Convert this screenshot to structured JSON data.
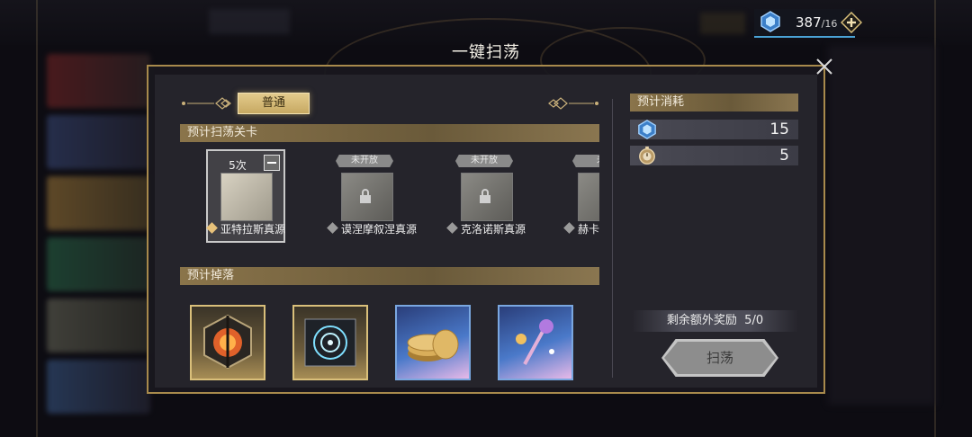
{
  "currency": {
    "amount": "387",
    "max": "/16",
    "icon": "stamina-crystal-icon",
    "add_icon": "plus-icon"
  },
  "dialog": {
    "title": "一键扫荡",
    "close_icon": "close-icon"
  },
  "tabs": [
    {
      "label": "普通",
      "selected": true
    }
  ],
  "stages_section": {
    "label": "预计扫荡关卡",
    "stages": [
      {
        "name": "亚特拉斯真源",
        "count": "5次",
        "selected": true,
        "locked": false
      },
      {
        "name": "谟涅摩叙涅真源",
        "locked_label": "未开放",
        "locked": true
      },
      {
        "name": "克洛诺斯真源",
        "locked_label": "未开放",
        "locked": true
      },
      {
        "name": "赫卡",
        "locked_label": "未",
        "locked": true
      }
    ]
  },
  "drops_section": {
    "label": "预计掉落",
    "items": [
      {
        "icon": "mystery-cube-icon",
        "rarity": "gold"
      },
      {
        "icon": "astrolabe-record-icon",
        "rarity": "gold"
      },
      {
        "icon": "gold-coins-icon",
        "rarity": "blue"
      },
      {
        "icon": "crystal-wand-icon",
        "rarity": "blue"
      }
    ]
  },
  "cost_section": {
    "label": "预计消耗",
    "rows": [
      {
        "icon": "stamina-crystal-icon",
        "value": "15"
      },
      {
        "icon": "pocket-watch-icon",
        "value": "5"
      }
    ]
  },
  "bonus": {
    "label": "剩余额外奖励",
    "value": "5/0"
  },
  "sweep_button": {
    "label": "扫荡"
  },
  "colors": {
    "accent_gold": "#c7a962",
    "frame_gold": "#a88a4c",
    "panel": "#25242b",
    "selected_diamond": "#e8c27a",
    "locked_diamond": "#9a9a9a"
  }
}
